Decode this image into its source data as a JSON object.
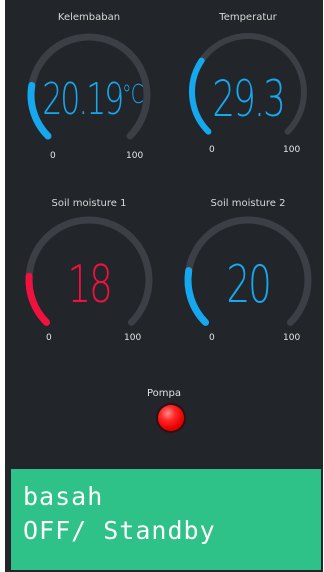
{
  "colors": {
    "background": "#22252a",
    "track": "#3c3f45",
    "accent_blue": "#16a8ee",
    "accent_red": "#f0113f",
    "pump_led": "#ff1a1a",
    "status_panel": "#2ec188"
  },
  "gauges": [
    {
      "label": "Kelembaban",
      "value": "20.19",
      "unit": "°C",
      "min": "0",
      "max": "100",
      "fraction": 0.2019,
      "color": "#16a8ee"
    },
    {
      "label": "Temperatur",
      "value": "29.3",
      "unit": "",
      "min": "0",
      "max": "100",
      "fraction": 0.293,
      "color": "#16a8ee"
    },
    {
      "label": "Soil moisture 1",
      "value": "18",
      "unit": "",
      "min": "0",
      "max": "100",
      "fraction": 0.18,
      "color": "#f0113f"
    },
    {
      "label": "Soil moisture 2",
      "value": "20",
      "unit": "",
      "min": "0",
      "max": "100",
      "fraction": 0.2,
      "color": "#16a8ee"
    }
  ],
  "pump": {
    "label": "Pompa",
    "state_color": "#ff1a1a"
  },
  "status": {
    "line1": "basah",
    "line2": "OFF/ Standby"
  }
}
